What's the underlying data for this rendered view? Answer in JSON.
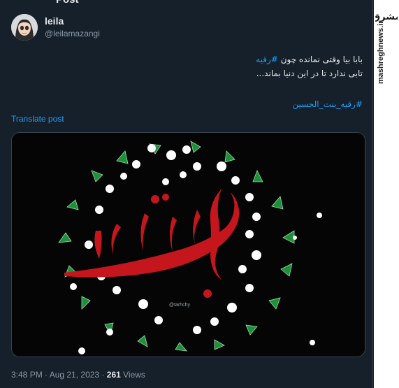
{
  "tweet": {
    "header_partial": "Post",
    "author_name": "leila",
    "author_handle": "@leilamazangi",
    "text_line1_prefix": "بابا بیا وقتی نمانده چون",
    "text_line1_hashtag": "#رقیه",
    "text_line2": "تابی ندارد تا در این دنیا بماند...",
    "hashtag_line": "#رقیه_بنت_الحسین",
    "translate_label": "Translate post",
    "timestamp": "3:48 PM · Aug 21, 2023 ·",
    "views_count": "261",
    "views_label": "Views"
  },
  "media": {
    "watermark": "@tarhchy",
    "colors": {
      "background": "#050505",
      "calligraphy": "#c4161c",
      "leaves": "#1e8f3a",
      "flowers": "#ffffff"
    }
  },
  "sidebar": {
    "logo_text": "مشرق",
    "site_text": "mashreghnews.ir"
  },
  "colors": {
    "page_bg": "#15202b",
    "link": "#1d9bf0",
    "muted": "#8b98a5",
    "border": "#38444d"
  }
}
